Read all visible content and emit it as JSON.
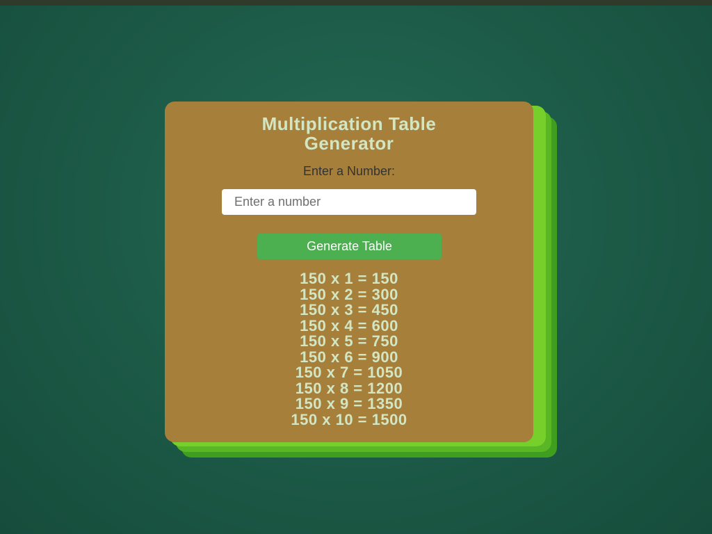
{
  "app": {
    "title": "Multiplication Table Generator",
    "title_line1": "Multiplication Table",
    "title_line2": "Generator",
    "input_label": "Enter a Number:",
    "input_placeholder": "Enter a number",
    "input_value": "",
    "button_label": "Generate Table",
    "results": [
      "150 x 1 = 150",
      "150 x 2 = 300",
      "150 x 3 = 450",
      "150 x 4 = 600",
      "150 x 5 = 750",
      "150 x 6 = 900",
      "150 x 7 = 1050",
      "150 x 8 = 1200",
      "150 x 9 = 1350",
      "150 x 10 = 1500"
    ]
  },
  "colors": {
    "card_background": "#a67f3b",
    "card_shadow": "#77cf2c",
    "button_background": "#4caf50",
    "title_text": "#d3e6c4",
    "page_background": "#1d5a47"
  }
}
